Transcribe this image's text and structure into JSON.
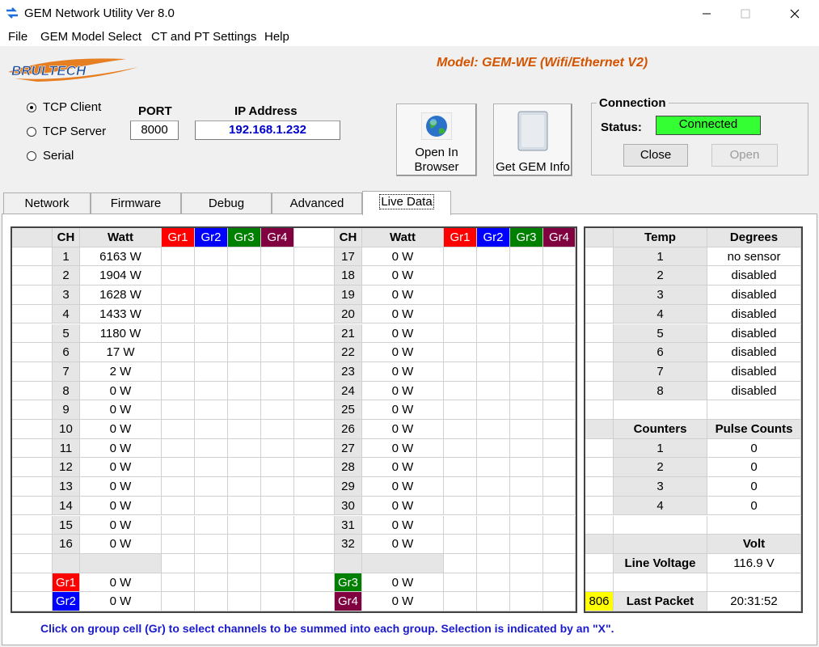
{
  "window": {
    "title": "GEM Network Utility   Ver 8.0"
  },
  "menu": [
    "File",
    "GEM Model Select",
    "CT and PT Settings",
    "Help"
  ],
  "model_text": "Model: GEM-WE (Wifi/Ethernet V2)",
  "logo_text": "BRULTECH",
  "conn_modes": [
    {
      "label": "TCP Client",
      "selected": true
    },
    {
      "label": "TCP Server",
      "selected": false
    },
    {
      "label": "Serial",
      "selected": false
    }
  ],
  "port": {
    "label": "PORT",
    "value": "8000"
  },
  "ip": {
    "label": "IP Address",
    "value": "192.168.1.232"
  },
  "buttons": {
    "open_browser_1": "Open In",
    "open_browser_2": "Browser",
    "gem_info": "Get GEM Info"
  },
  "connection": {
    "title": "Connection",
    "status_label": "Status:",
    "status_value": "Connected",
    "close": "Close",
    "open": "Open"
  },
  "tabs": [
    "Network",
    "Firmware",
    "Debug",
    "Advanced",
    "Live Data"
  ],
  "channel_headers": {
    "ch": "CH",
    "watt": "Watt",
    "gr1": "Gr1",
    "gr2": "Gr2",
    "gr3": "Gr3",
    "gr4": "Gr4"
  },
  "channels_left": [
    {
      "ch": "1",
      "watt": "6163 W"
    },
    {
      "ch": "2",
      "watt": "1904 W"
    },
    {
      "ch": "3",
      "watt": "1628 W"
    },
    {
      "ch": "4",
      "watt": "1433 W"
    },
    {
      "ch": "5",
      "watt": "1180 W"
    },
    {
      "ch": "6",
      "watt": "17 W"
    },
    {
      "ch": "7",
      "watt": "2 W"
    },
    {
      "ch": "8",
      "watt": "0 W"
    },
    {
      "ch": "9",
      "watt": "0 W"
    },
    {
      "ch": "10",
      "watt": "0 W"
    },
    {
      "ch": "11",
      "watt": "0 W"
    },
    {
      "ch": "12",
      "watt": "0 W"
    },
    {
      "ch": "13",
      "watt": "0 W"
    },
    {
      "ch": "14",
      "watt": "0 W"
    },
    {
      "ch": "15",
      "watt": "0 W"
    },
    {
      "ch": "16",
      "watt": "0 W"
    }
  ],
  "channels_right": [
    {
      "ch": "17",
      "watt": "0 W"
    },
    {
      "ch": "18",
      "watt": "0 W"
    },
    {
      "ch": "19",
      "watt": "0 W"
    },
    {
      "ch": "20",
      "watt": "0 W"
    },
    {
      "ch": "21",
      "watt": "0 W"
    },
    {
      "ch": "22",
      "watt": "0 W"
    },
    {
      "ch": "23",
      "watt": "0 W"
    },
    {
      "ch": "24",
      "watt": "0 W"
    },
    {
      "ch": "25",
      "watt": "0 W"
    },
    {
      "ch": "26",
      "watt": "0 W"
    },
    {
      "ch": "27",
      "watt": "0 W"
    },
    {
      "ch": "28",
      "watt": "0 W"
    },
    {
      "ch": "29",
      "watt": "0 W"
    },
    {
      "ch": "30",
      "watt": "0 W"
    },
    {
      "ch": "31",
      "watt": "0 W"
    },
    {
      "ch": "32",
      "watt": "0 W"
    }
  ],
  "group_totals": [
    {
      "label": "Gr1",
      "watt": "0 W"
    },
    {
      "label": "Gr2",
      "watt": "0 W"
    },
    {
      "label": "Gr3",
      "watt": "0 W"
    },
    {
      "label": "Gr4",
      "watt": "0 W"
    }
  ],
  "temp": {
    "headers": [
      "Temp",
      "Degrees"
    ],
    "rows": [
      {
        "id": "1",
        "value": "no sensor"
      },
      {
        "id": "2",
        "value": "disabled"
      },
      {
        "id": "3",
        "value": "disabled"
      },
      {
        "id": "4",
        "value": "disabled"
      },
      {
        "id": "5",
        "value": "disabled"
      },
      {
        "id": "6",
        "value": "disabled"
      },
      {
        "id": "7",
        "value": "disabled"
      },
      {
        "id": "8",
        "value": "disabled"
      }
    ]
  },
  "counters": {
    "headers": [
      "Counters",
      "Pulse Counts"
    ],
    "rows": [
      {
        "id": "1",
        "value": "0"
      },
      {
        "id": "2",
        "value": "0"
      },
      {
        "id": "3",
        "value": "0"
      },
      {
        "id": "4",
        "value": "0"
      }
    ]
  },
  "voltage": {
    "header": "Volt",
    "label": "Line Voltage",
    "value": "116.9 V"
  },
  "last_packet": {
    "count": "806",
    "label": "Last Packet",
    "time": "20:31:52"
  },
  "footer_note": "Click on group cell (Gr) to select channels to be summed into each group. Selection is indicated by an \"X\"."
}
